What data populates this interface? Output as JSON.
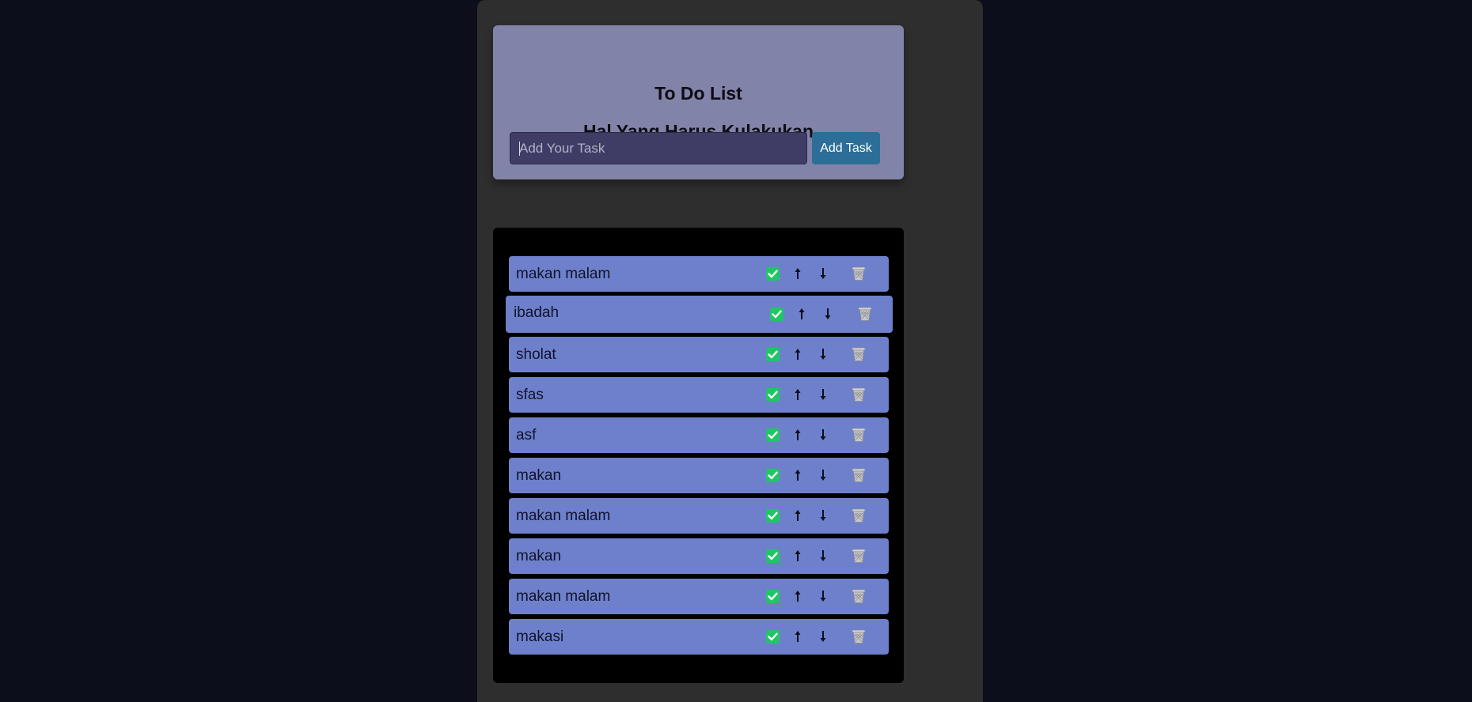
{
  "header": {
    "title": "To Do List",
    "subtitle": "Hal Yang Harus Kulakukan"
  },
  "input": {
    "placeholder": "Add Your Task",
    "value": ""
  },
  "add_button_label": "Add Task",
  "icons": {
    "done": "check-icon",
    "move_up": "arrow-up-icon",
    "move_down": "arrow-down-icon",
    "delete": "trash-icon"
  },
  "colors": {
    "page_background": "#0d0e1c",
    "app_column": "#2e2e2f",
    "header_card": "#8283a9",
    "input_background": "#3f3c66",
    "add_button": "#2c6e97",
    "list_panel": "#000000",
    "task_item": "#6e80cb",
    "check_green": "#1fc764"
  },
  "tasks": [
    {
      "text": "makan malam"
    },
    {
      "text": "ibadah"
    },
    {
      "text": "sholat"
    },
    {
      "text": "sfas"
    },
    {
      "text": "asf"
    },
    {
      "text": "makan"
    },
    {
      "text": "makan malam"
    },
    {
      "text": "makan"
    },
    {
      "text": "makan malam"
    },
    {
      "text": "makasi"
    }
  ]
}
